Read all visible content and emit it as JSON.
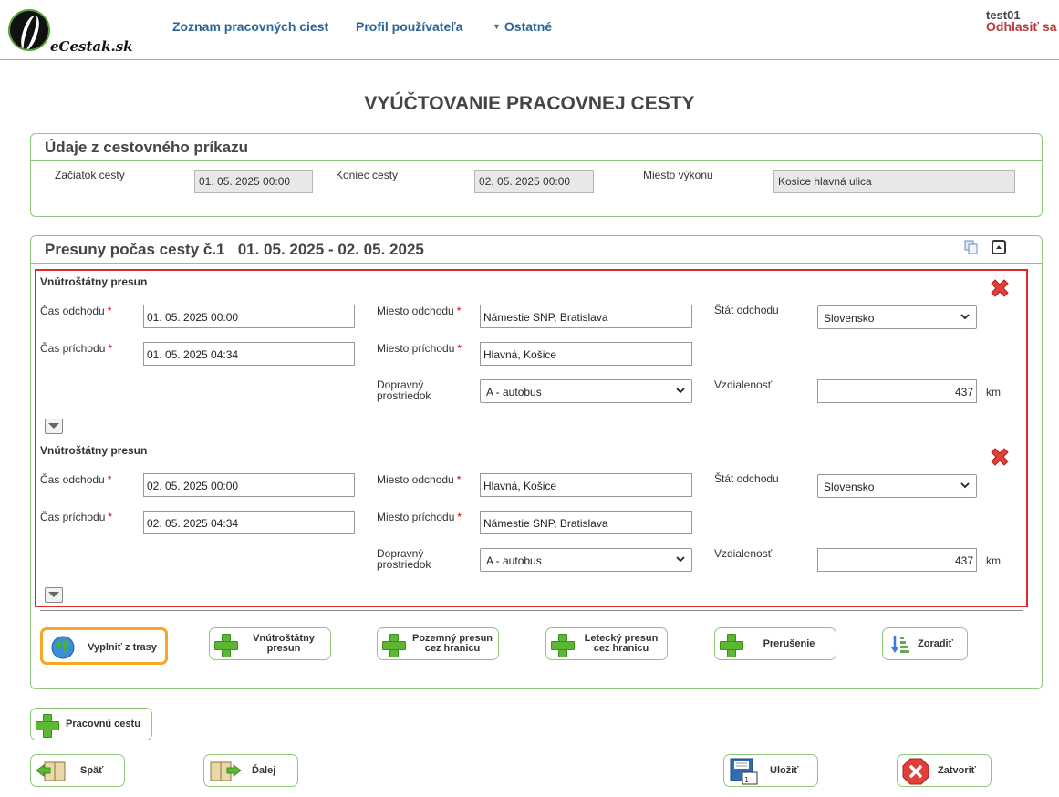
{
  "header": {
    "logo_text": "eCestak.sk",
    "nav": [
      "Zoznam pracovných ciest",
      "Profil používateľa",
      "Ostatné"
    ],
    "user": "test01",
    "logout": "Odhlasiť sa"
  },
  "page_title": "VYÚČTOVANIE PRACOVNEJ CESTY",
  "trip_info": {
    "title": "Údaje z cestovného príkazu",
    "start_label": "Začiatok cesty",
    "start_value": "01. 05. 2025 00:00",
    "end_label": "Koniec cesty",
    "end_value": "02. 05. 2025 00:00",
    "place_label": "Miesto výkonu",
    "place_value": "Kosice hlavná ulica"
  },
  "transfers": {
    "title": "Presuny počas cesty č.1",
    "date_range": "01. 05. 2025 - 02. 05. 2025",
    "segments": [
      {
        "type": "Vnútroštátny presun",
        "departure_time_label": "Čas odchodu",
        "departure_time": "01. 05. 2025 00:00",
        "arrival_time_label": "Čas príchodu",
        "arrival_time": "01. 05. 2025 04:34",
        "departure_place_label": "Miesto odchodu",
        "departure_place": "Námestie SNP, Bratislava",
        "arrival_place_label": "Miesto príchodu",
        "arrival_place": "Hlavná, Košice",
        "transport_label": "Dopravný prostriedok",
        "transport": "A - autobus",
        "country_label": "Štát odchodu",
        "country": "Slovensko",
        "distance_label": "Vzdialenosť",
        "distance": "437",
        "distance_unit": "km"
      },
      {
        "type": "Vnútroštátny presun",
        "departure_time_label": "Čas odchodu",
        "departure_time": "02. 05. 2025 00:00",
        "arrival_time_label": "Čas príchodu",
        "arrival_time": "02. 05. 2025 04:34",
        "departure_place_label": "Miesto odchodu",
        "departure_place": "Hlavná, Košice",
        "arrival_place_label": "Miesto príchodu",
        "arrival_place": "Námestie SNP, Bratislava",
        "transport_label": "Dopravný prostriedok",
        "transport": "A - autobus",
        "country_label": "Štát odchodu",
        "country": "Slovensko",
        "distance_label": "Vzdialenosť",
        "distance": "437",
        "distance_unit": "km"
      }
    ],
    "actions": {
      "fill_route": "Vyplniť z trasy",
      "domestic": "Vnútroštátny presun",
      "ground_border": "Pozemný presun cez hranicu",
      "air_border": "Letecký presun cez hranicu",
      "interruption": "Prerušenie",
      "sort": "Zoradiť"
    }
  },
  "footer": {
    "add_trip": "Pracovnú cestu",
    "back": "Späť",
    "next": "Ďalej",
    "save": "Uložiť",
    "close": "Zatvoriť"
  },
  "colors": {
    "border_green": "#8fc77f",
    "nav_blue": "#2a6496",
    "logout_red": "#b83a3a",
    "highlight_orange": "#f5a623",
    "error_red": "#e02a2a"
  }
}
